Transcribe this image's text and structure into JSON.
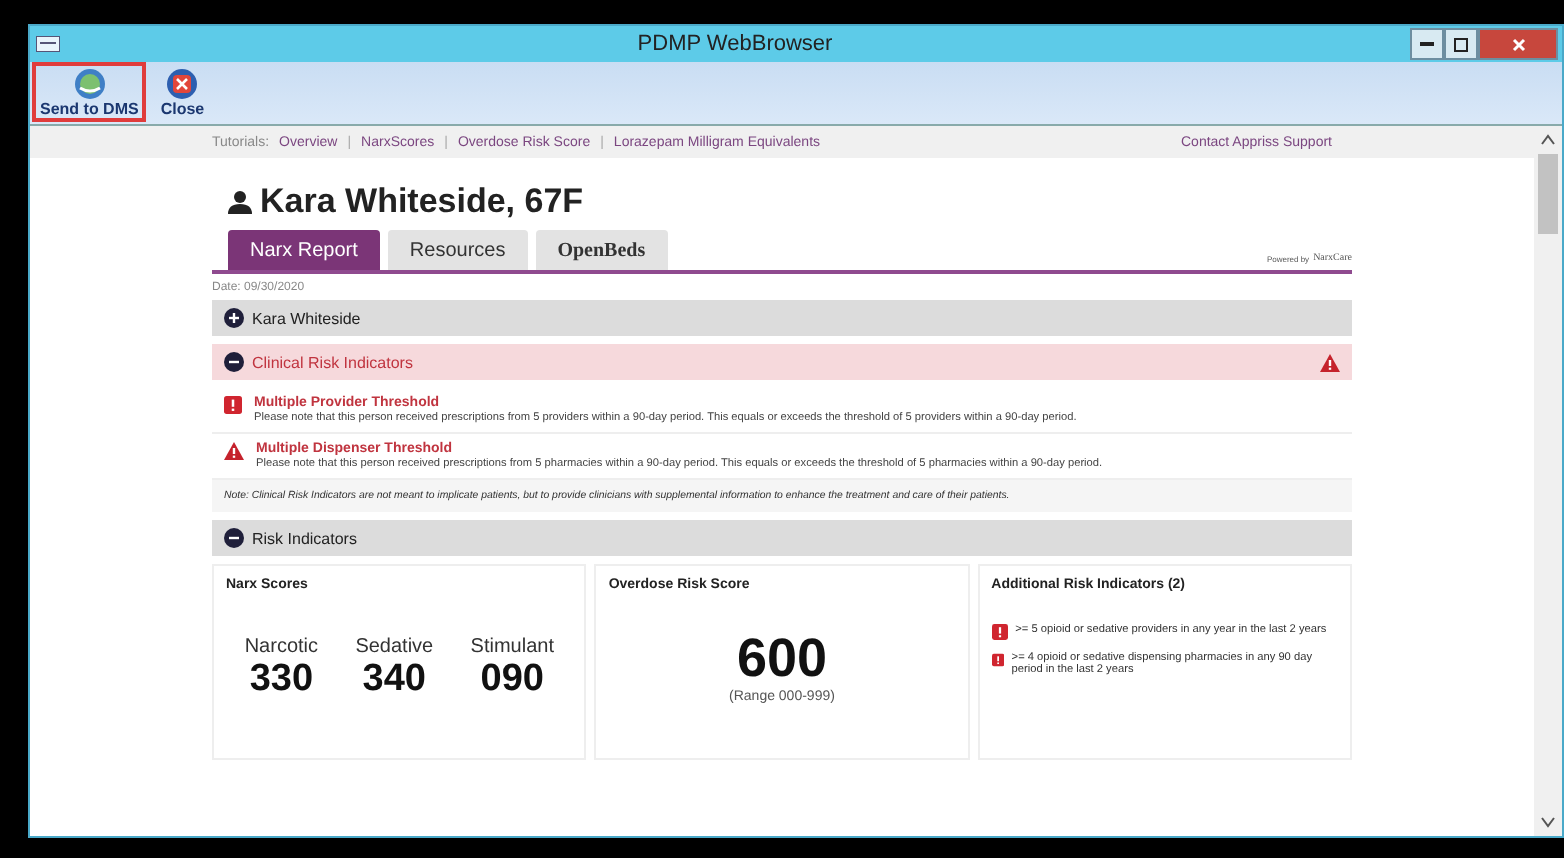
{
  "window": {
    "title": "PDMP WebBrowser"
  },
  "toolbar": [
    {
      "kind": "send",
      "label": "Send to DMS",
      "selected": true
    },
    {
      "kind": "close",
      "label": "Close",
      "selected": false
    }
  ],
  "tutorials": {
    "label": "Tutorials:",
    "separator": "|",
    "links": [
      "Overview",
      "NarxScores",
      "Overdose Risk Score",
      "Lorazepam Milligram Equivalents"
    ],
    "support": "Contact Appriss Support"
  },
  "patient": {
    "name": "Kara Whiteside, 67F"
  },
  "tabs": [
    {
      "kind": "text",
      "label": "Narx Report",
      "selected": true
    },
    {
      "kind": "text",
      "label": "Resources",
      "selected": false
    },
    {
      "kind": "logo",
      "label": "OpenBeds",
      "selected": false
    }
  ],
  "powered_by": {
    "label": "Powered by",
    "brand": "NarxCare"
  },
  "date": "Date: 09/30/2020",
  "sections": [
    {
      "kind": "plain",
      "title": "Kara Whiteside",
      "expanded": false
    },
    {
      "kind": "alert",
      "title": "Clinical Risk Indicators",
      "expanded": true
    },
    {
      "kind": "plain",
      "title": "Risk Indicators",
      "expanded": true
    }
  ],
  "clinical_indicators": [
    {
      "kind": "error",
      "title": "Multiple Provider Threshold",
      "text": "Please note that this person received prescriptions from 5 providers within a 90-day period. This equals or exceeds the threshold of 5 providers within a 90-day period."
    },
    {
      "kind": "warning",
      "title": "Multiple Dispenser Threshold",
      "text": "Please note that this person received prescriptions from 5 pharmacies within a 90-day period. This equals or exceeds the threshold of 5 pharmacies within a 90-day period."
    }
  ],
  "note": "Note: Clinical Risk Indicators are not meant to implicate patients, but to provide clinicians with supplemental information to enhance the treatment and care of their patients.",
  "narx_scores": {
    "title": "Narx Scores",
    "scores": [
      {
        "label": "Narcotic",
        "value": "330"
      },
      {
        "label": "Sedative",
        "value": "340"
      },
      {
        "label": "Stimulant",
        "value": "090"
      }
    ]
  },
  "overdose": {
    "title": "Overdose Risk Score",
    "value": "600",
    "range": "(Range 000-999)"
  },
  "additional": {
    "title": "Additional Risk Indicators (2)",
    "items": [
      ">= 5 opioid or sedative providers in any year in the last 2 years",
      ">= 4 opioid or sedative dispensing pharmacies in any 90 day period in the last 2 years"
    ]
  }
}
